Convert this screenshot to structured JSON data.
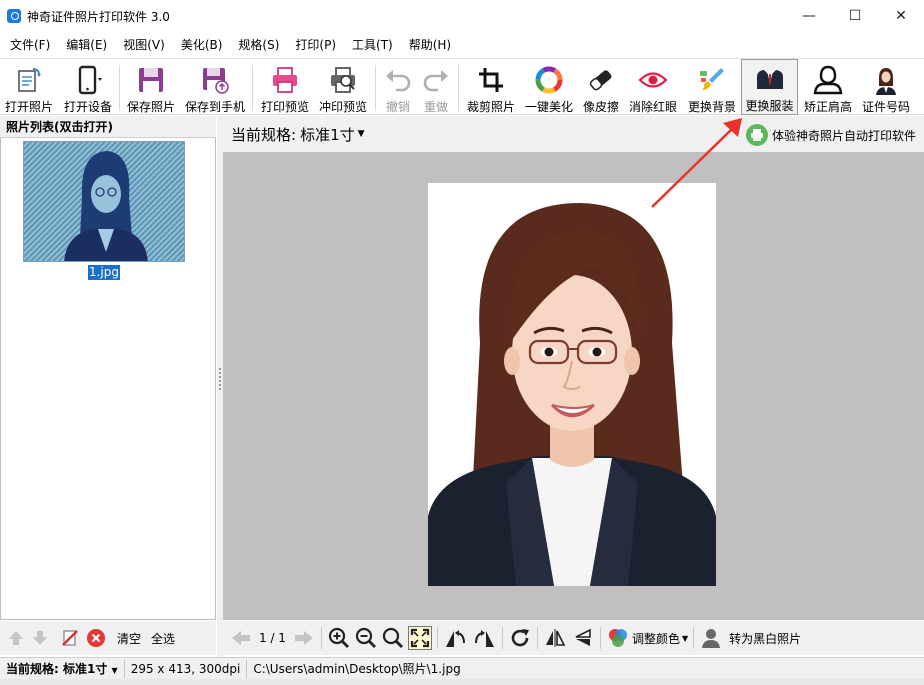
{
  "window": {
    "title": "神奇证件照片打印软件 3.0",
    "minimize": "—",
    "maximize": "☐",
    "close": "✕"
  },
  "menu": [
    "文件(F)",
    "编辑(E)",
    "视图(V)",
    "美化(B)",
    "规格(S)",
    "打印(P)",
    "工具(T)",
    "帮助(H)"
  ],
  "toolbar": {
    "open_photo": "打开照片",
    "open_device": "打开设备",
    "save_photo": "保存照片",
    "save_to_phone": "保存到手机",
    "print_preview": "打印预览",
    "develop_preview": "冲印预览",
    "undo": "撤销",
    "redo": "重做",
    "crop": "裁剪照片",
    "beautify": "一键美化",
    "eraser": "像皮擦",
    "red_eye": "消除红眼",
    "change_bg": "更换背景",
    "change_clothes": "更换服装",
    "shoulder": "矫正肩高",
    "id_number": "证件号码"
  },
  "left_panel": {
    "header": "照片列表(双击打开)",
    "items": [
      {
        "label": "1.jpg"
      }
    ],
    "clear": "清空",
    "select_all": "全选"
  },
  "main": {
    "spec_label": "当前规格:",
    "spec_value": "标准1寸",
    "promo": "体验神奇照片自动打印软件",
    "page_indicator": "1 / 1",
    "adjust_color": "调整颜色",
    "to_bw": "转为黑白照片"
  },
  "status": {
    "spec_label": "当前规格:",
    "spec_value": "标准1寸",
    "size": "295 x 413, 300dpi",
    "path": "C:\\Users\\admin\\Desktop\\照片\\1.jpg"
  },
  "colors": {
    "accent_blue": "#1c6fc7",
    "canvas_gray": "#c0c0c0",
    "annotation_red": "#e8322c",
    "suit": "#1c2130",
    "hair": "#5a2a1c"
  }
}
